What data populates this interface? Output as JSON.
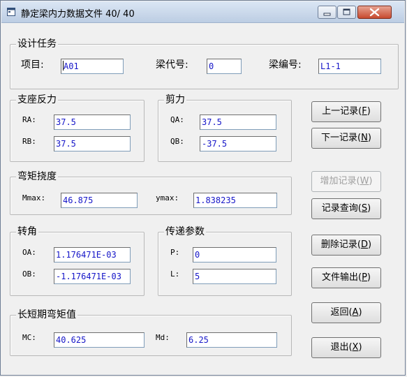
{
  "window": {
    "title": "静定梁内力数据文件  40/ 40"
  },
  "design_task": {
    "title": "设计任务",
    "project_label": "项目:",
    "project_value": "A01",
    "beam_code_label": "梁代号:",
    "beam_code_value": "0",
    "beam_number_label": "梁编号:",
    "beam_number_value": "L1-1"
  },
  "support_reaction": {
    "title": "支座反力",
    "ra_label": "RA:",
    "ra_value": "37.5",
    "rb_label": "RB:",
    "rb_value": "37.5"
  },
  "shear": {
    "title": "剪力",
    "qa_label": "QA:",
    "qa_value": "37.5",
    "qb_label": "QB:",
    "qb_value": "-37.5"
  },
  "moment_deflection": {
    "title": "弯矩挠度",
    "mmax_label": "Mmax:",
    "mmax_value": "46.875",
    "ymax_label": "ymax:",
    "ymax_value": "1.838235"
  },
  "rotation": {
    "title": "转角",
    "oa_label": "OA:",
    "oa_value": "1.176471E-03",
    "ob_label": "OB:",
    "ob_value": "-1.176471E-03"
  },
  "transfer_params": {
    "title": "传递参数",
    "p_label": "P:",
    "p_value": "0",
    "l_label": "L:",
    "l_value": "5"
  },
  "long_short_moment": {
    "title": "长短期弯矩值",
    "mc_label": "MC:",
    "mc_value": "40.625",
    "md_label": "Md:",
    "md_value": "6.25"
  },
  "buttons": {
    "prev_text": "上一记录(",
    "prev_key": "F",
    "next_text": "下一记录(",
    "next_key": "N",
    "add_text": "增加记录(",
    "add_key": "W",
    "query_text": "记录查询(",
    "query_key": "S",
    "delete_text": "删除记录(",
    "delete_key": "D",
    "export_text": "文件输出(",
    "export_key": "P",
    "back_text": "返回(",
    "back_key": "A",
    "exit_text": "退出(",
    "exit_key": "X",
    "close_paren": ")"
  }
}
